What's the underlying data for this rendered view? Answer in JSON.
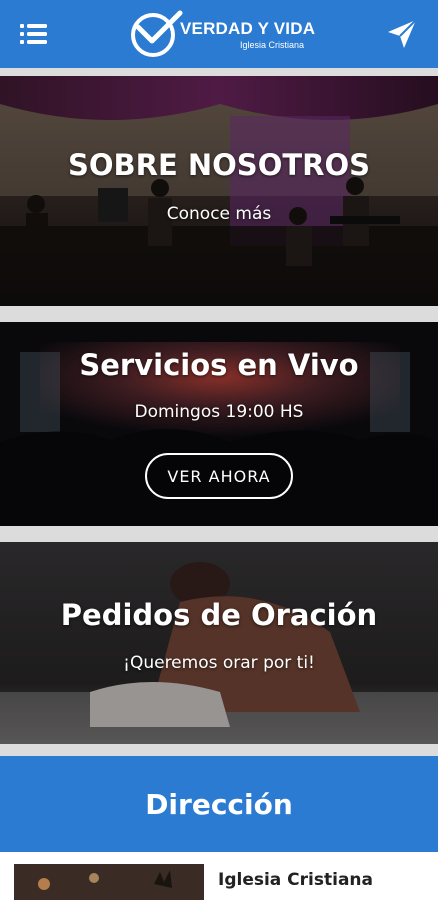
{
  "header": {
    "logo_title": "VERDAD Y VIDA",
    "logo_subtitle": "Iglesia Cristiana",
    "menu_icon": "hamburger-menu-icon",
    "send_icon": "paper-plane-icon",
    "background_color": "#2b7bd3"
  },
  "cards": [
    {
      "title": "SOBRE NOSOTROS",
      "subtitle": "Conoce más"
    },
    {
      "title": "Servicios en Vivo",
      "subtitle": "Domingos 19:00 HS",
      "button_label": "VER AHORA"
    },
    {
      "title": "Pedidos de Oración",
      "subtitle": "¡Queremos orar por ti!"
    }
  ],
  "address": {
    "title": "Dirección",
    "church_name": "Iglesia Cristiana"
  }
}
